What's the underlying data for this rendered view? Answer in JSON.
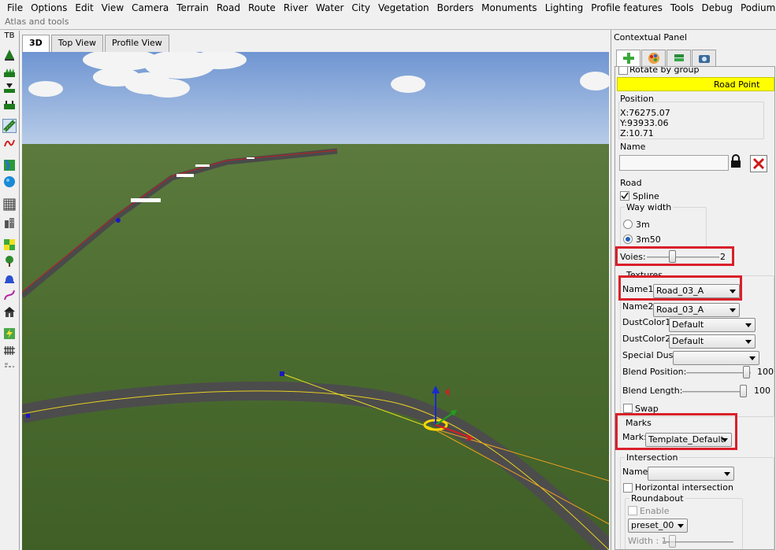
{
  "menu": [
    "File",
    "Options",
    "Edit",
    "View",
    "Camera",
    "Terrain",
    "Road",
    "Route",
    "River",
    "Water",
    "City",
    "Vegetation",
    "Borders",
    "Monuments",
    "Lighting",
    "Profile features",
    "Tools",
    "Debug",
    "Podium"
  ],
  "atlas_label": "Atlas and tools",
  "toolbar": {
    "label": "TB"
  },
  "view_tabs": [
    "3D",
    "Top View",
    "Profile View"
  ],
  "panel": {
    "title": "Contextual Panel",
    "rotate_by_group": "Rotate by group",
    "header": "Road Point",
    "position": {
      "title": "Position",
      "x": "X:76275.07",
      "y": "Y:93933.06",
      "z": "Z:10.71"
    },
    "name": {
      "title": "Name",
      "value": ""
    },
    "road": {
      "title": "Road",
      "spline": "Spline",
      "way_width": "Way width",
      "opt1": "3m",
      "opt2": "3m50",
      "voies_label": "Voies:",
      "voies_value": "2"
    },
    "textures": {
      "title": "Textures",
      "name1_label": "Name1:",
      "name1_value": "Road_03_A",
      "name2_label": "Name2:",
      "name2_value": "Road_03_A",
      "dust1_label": "DustColor1:",
      "dust1_value": "Default",
      "dust2_label": "DustColor2:",
      "dust2_value": "Default",
      "special_label": "Special Dust:",
      "special_value": "",
      "blend_pos_label": "Blend Position:",
      "blend_pos_value": "100",
      "blend_len_label": "Blend Length:",
      "blend_len_value": "100",
      "swap": "Swap"
    },
    "marks": {
      "title": "Marks",
      "label": "Mark:",
      "value": "Template_Default"
    },
    "intersection": {
      "title": "Intersection",
      "name_label": "Name:",
      "name_value": "",
      "horizontal": "Horizontal intersection",
      "roundabout": "Roundabout",
      "enable": "Enable",
      "preset": "preset_00",
      "width_label": "Width : 1"
    }
  },
  "colors": {
    "header_yellow": "#ffff00",
    "highlight_red": "#d9202a",
    "sky": "#88a8d8",
    "grass": "#4f6e32"
  }
}
